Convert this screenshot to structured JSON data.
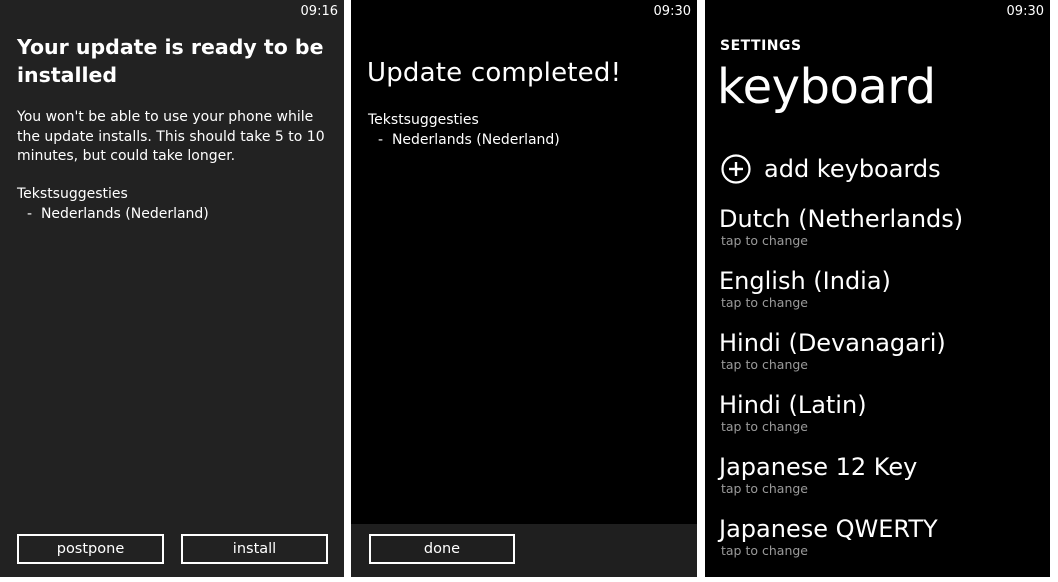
{
  "screen1": {
    "clock": "09:16",
    "title": "Your update is ready to be installed",
    "body": "You won't be able to use your phone while the update installs. This should take 5 to 10 minutes, but could take longer.",
    "section_title": "Tekstsuggesties",
    "section_item": "-  Nederlands (Nederland)",
    "postpone_label": "postpone",
    "install_label": "install"
  },
  "screen2": {
    "clock": "09:30",
    "title": "Update completed!",
    "section_title": "Tekstsuggesties",
    "section_item": "-  Nederlands (Nederland)",
    "done_label": "done"
  },
  "screen3": {
    "clock": "09:30",
    "header": "SETTINGS",
    "title": "keyboard",
    "add_label": "add keyboards",
    "add_icon": "plus-circle-icon",
    "keyboards": [
      {
        "name": "Dutch (Netherlands)",
        "sub": "tap to change"
      },
      {
        "name": "English (India)",
        "sub": "tap to change"
      },
      {
        "name": "Hindi (Devanagari)",
        "sub": "tap to change"
      },
      {
        "name": "Hindi (Latin)",
        "sub": "tap to change"
      },
      {
        "name": "Japanese 12 Key",
        "sub": "tap to change"
      },
      {
        "name": "Japanese QWERTY",
        "sub": "tap to change"
      }
    ]
  },
  "colors": {
    "screen1_bg": "#222222",
    "screen2_bg": "#000000",
    "screen3_bg": "#000000",
    "text": "#ffffff",
    "subtext": "#9a9a9a",
    "divider": "#ffffff"
  }
}
